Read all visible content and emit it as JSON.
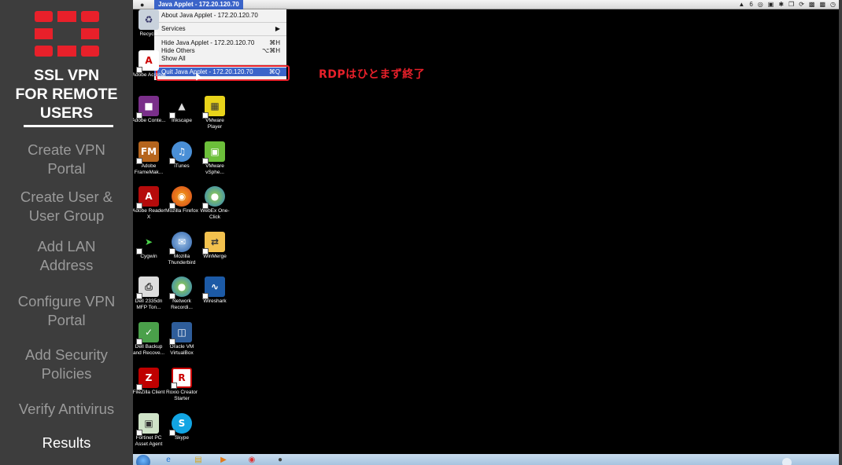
{
  "sidebar": {
    "title_lines": [
      "SSL VPN",
      "FOR REMOTE",
      "USERS"
    ],
    "logo_icon": "fortinet-logo",
    "nav_items": [
      {
        "line1": "Create VPN",
        "line2": "Portal"
      },
      {
        "line1": "Create User &",
        "line2": "User Group"
      },
      {
        "line1": "Add LAN",
        "line2": "Address"
      },
      {
        "line1": "Configure VPN",
        "line2": "Portal"
      },
      {
        "line1": "Add Security",
        "line2": "Policies"
      },
      {
        "line1": "Verify Antivirus",
        "line2": ""
      },
      {
        "line1": "Results",
        "line2": ""
      }
    ],
    "active_item": "Results",
    "colors": {
      "background": "#3d3d3d",
      "logo": "#e8202a",
      "inactive_text": "#9a9a9a",
      "active_text": "#ffffff"
    }
  },
  "remote": {
    "menubar": {
      "apple_icon": "apple-icon",
      "app_menu": "Java Applet - 172.20.120.70",
      "status_icons": [
        "adobe-icon",
        "wifi-icon",
        "screen-icon",
        "bluetooth-icon",
        "window-icon",
        "sync-icon",
        "display-icon",
        "volume-icon",
        "clock-icon"
      ],
      "status_text": "6"
    },
    "dropdown": {
      "about": "About Java Applet - 172.20.120.70",
      "services": "Services",
      "hide": "Hide Java Applet - 172.20.120.70",
      "hide_shortcut": "⌘H",
      "hide_others": "Hide Others",
      "hide_others_shortcut": "⌥⌘H",
      "show_all": "Show All",
      "quit": "Quit Java Applet - 172.20.120.70",
      "quit_shortcut": "⌘Q"
    },
    "annotation": "RDPはひとまず終了",
    "desktop_icons": [
      {
        "label": "Recycle",
        "icon": "recycle-bin-icon"
      },
      {
        "label": "Adobe Acrobat",
        "icon": "acrobat-icon"
      },
      {
        "label": "Adobe Conte...",
        "icon": "adobe-contribute-icon"
      },
      {
        "label": "Inkscape",
        "icon": "inkscape-icon"
      },
      {
        "label": "VMware Player",
        "icon": "vmware-player-icon"
      },
      {
        "label": "Adobe FrameMak...",
        "icon": "framemaker-icon"
      },
      {
        "label": "iTunes",
        "icon": "itunes-icon"
      },
      {
        "label": "VMware vSphe...",
        "icon": "vsphere-icon"
      },
      {
        "label": "Adobe Reader X",
        "icon": "adobe-reader-icon"
      },
      {
        "label": "Mozilla Firefox",
        "icon": "firefox-icon"
      },
      {
        "label": "WebEx One-Click",
        "icon": "webex-icon"
      },
      {
        "label": "Cygwin",
        "icon": "cygwin-icon"
      },
      {
        "label": "Mozilla Thunderbird",
        "icon": "thunderbird-icon"
      },
      {
        "label": "WinMerge",
        "icon": "winmerge-icon"
      },
      {
        "label": "Dell 2335dn MFP Ton...",
        "icon": "printer-icon"
      },
      {
        "label": "Network Recordi...",
        "icon": "network-recording-icon"
      },
      {
        "label": "Wireshark",
        "icon": "wireshark-icon"
      },
      {
        "label": "Dell Backup and Recove...",
        "icon": "dell-backup-icon"
      },
      {
        "label": "Oracle VM VirtualBox",
        "icon": "virtualbox-icon"
      },
      {
        "label": "FileZilla Client",
        "icon": "filezilla-icon"
      },
      {
        "label": "Roxio Creator Starter",
        "icon": "roxio-icon"
      },
      {
        "label": "Fortinet PC Asset Agent",
        "icon": "fortinet-agent-icon"
      },
      {
        "label": "Skype",
        "icon": "skype-icon"
      }
    ],
    "taskbar_items": [
      "start-button",
      "ie-icon",
      "explorer-icon",
      "media-player-icon",
      "chrome-icon",
      "remote-app-icon"
    ]
  }
}
